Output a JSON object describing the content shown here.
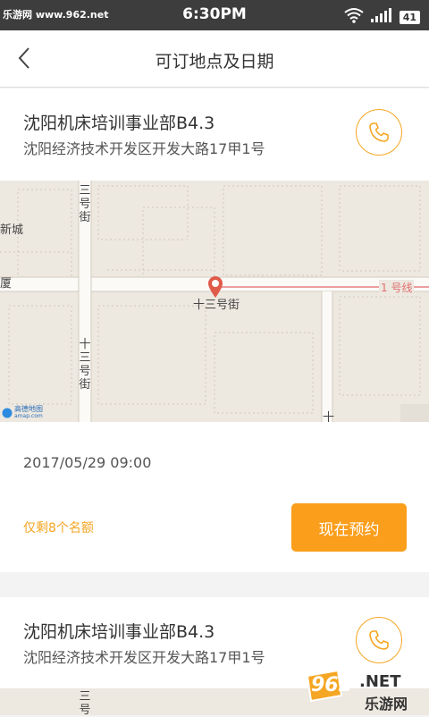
{
  "status_bar": {
    "watermark": "乐游网 www.962.net",
    "time": "6:30PM",
    "battery": "41"
  },
  "header": {
    "title": "可订地点及日期"
  },
  "locations": [
    {
      "name": "沈阳机床培训事业部B4.3",
      "address": "沈阳经济技术开发区开发大路17甲1号"
    },
    {
      "name": "沈阳机床培训事业部B4.3",
      "address": "沈阳经济技术开发区开发大路17甲1号"
    }
  ],
  "map": {
    "labels": {
      "xincheng": "新城",
      "xia": "厦",
      "street_h": "十三号街",
      "line1": "1 号线",
      "street_v_top": "三号街",
      "street_v_mid": "十三号街",
      "street_v_bottom": "十",
      "brand": "高德地图",
      "brand_sub": "amap.com",
      "street_v_next": "三号"
    }
  },
  "booking": {
    "datetime": "2017/05/29 09:00",
    "remaining": "仅剩8个名额",
    "button": "现在预约"
  },
  "watermark_bottom": {
    "number": "962",
    "net": ".NET",
    "site": "乐游网"
  }
}
